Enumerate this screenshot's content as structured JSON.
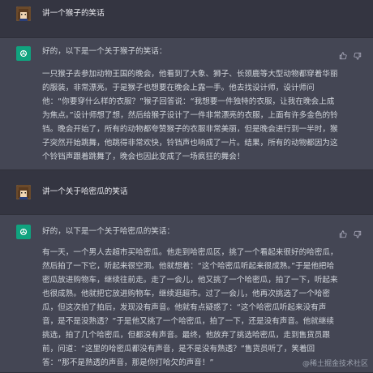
{
  "conversation": [
    {
      "role": "user",
      "text": "讲一个猴子的笑话"
    },
    {
      "role": "assistant",
      "intro": "好的，以下是一个关于猴子的笑话：",
      "text": "一只猴子去参加动物王国的晚会，他看到了大象、狮子、长颈鹿等大型动物都穿着华丽的服装，非常漂亮。于是猴子也想要在晚会上露一手。他去找设计师，设计师问他：“你要穿什么样的衣服？”猴子回答说：“我想要一件独特的衣服，让我在晚会上成为焦点。”设计师想了想，然后给猴子设计了一件非常漂亮的衣服，上面有许多金色的铃铛。晚会开始了，所有的动物都夸赞猴子的衣服非常美丽，但是晚会进行到一半时，猴子突然开始跳舞，他跳得非常欢快，铃铛声也响成了一片。结果，所有的动物都因为这个铃铛声跟着跳舞了，晚会也因此变成了一场疯狂的舞会！"
    },
    {
      "role": "user",
      "text": "讲一个关于哈密瓜的笑话"
    },
    {
      "role": "assistant",
      "intro": "好的，以下是一个关于哈密瓜的笑话：",
      "text": "有一天，一个男人去超市买哈密瓜。他走到哈密瓜区，挑了一个看起来很好的哈密瓜，然后拍了一下它，听起来很空洞。他就想着：“这个哈密瓜听起来很成熟。”于是他把哈密瓜放进购物车，继续往前走。走了一会儿，他又挑了一个哈密瓜，拍了一下，听起来也很成熟。他就把它放进购物车，继续逛超市。过了一会儿，他再次挑选了一个哈密瓜，但这次拍了拍后，发现没有声音。他就有点疑惑了：“这个哈密瓜听起来没有声音，是不是没熟透？”于是他又挑了一个哈密瓜，拍了一下，还是没有声音。他就继续挑选，拍了几个哈密瓜，但都没有声音。最终，他放弃了挑选哈密瓜，走到售货员跟前，问道：“这里的哈密瓜都没有声音，是不是没有熟透？”售货员听了，笑着回答：“那不是熟透的声音，那是你打哈欠的声音！”"
    }
  ],
  "actions": {
    "thumbs_up": "thumbs-up-icon",
    "thumbs_down": "thumbs-down-icon"
  },
  "watermark": "@稀土掘金技术社区",
  "colors": {
    "background": "#343541",
    "assistant_row": "#444654",
    "accent": "#10a37f",
    "text": "#d1d5db"
  }
}
